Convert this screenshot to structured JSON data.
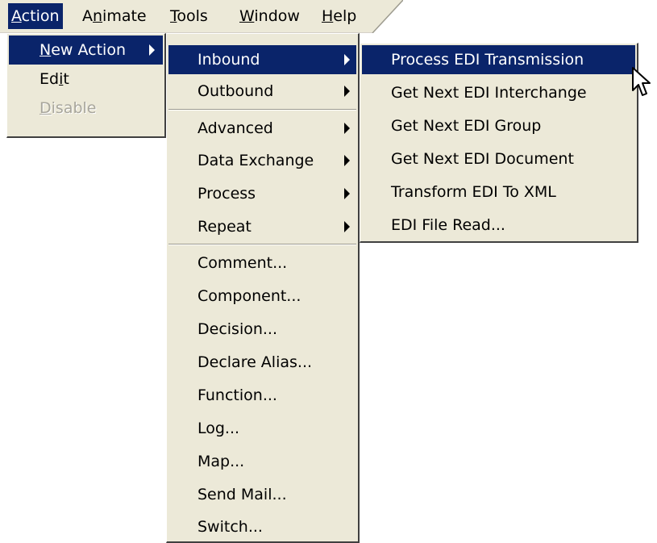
{
  "menubar": {
    "items": [
      {
        "pre": "",
        "acc": "A",
        "post": "ction"
      },
      {
        "pre": "A",
        "acc": "n",
        "post": "imate"
      },
      {
        "pre": "",
        "acc": "T",
        "post": "ools"
      },
      {
        "pre": "",
        "acc": "W",
        "post": "indow"
      },
      {
        "pre": "",
        "acc": "H",
        "post": "elp"
      }
    ]
  },
  "action_menu": {
    "new_action": {
      "pre": "",
      "acc": "N",
      "post": "ew Action"
    },
    "edit": {
      "pre": "Ed",
      "acc": "i",
      "post": "t"
    },
    "disable": {
      "pre": "",
      "acc": "D",
      "post": "isable"
    }
  },
  "new_action_menu": {
    "items": [
      "Inbound",
      "Outbound",
      "Advanced",
      "Data Exchange",
      "Process",
      "Repeat",
      "Comment...",
      "Component...",
      "Decision...",
      "Declare Alias...",
      "Function...",
      "Log...",
      "Map...",
      "Send Mail...",
      "Switch..."
    ]
  },
  "inbound_menu": {
    "items": [
      "Process EDI Transmission",
      "Get Next EDI Interchange",
      "Get Next EDI Group",
      "Get Next EDI Document",
      "Transform EDI To XML",
      "EDI File Read..."
    ]
  }
}
